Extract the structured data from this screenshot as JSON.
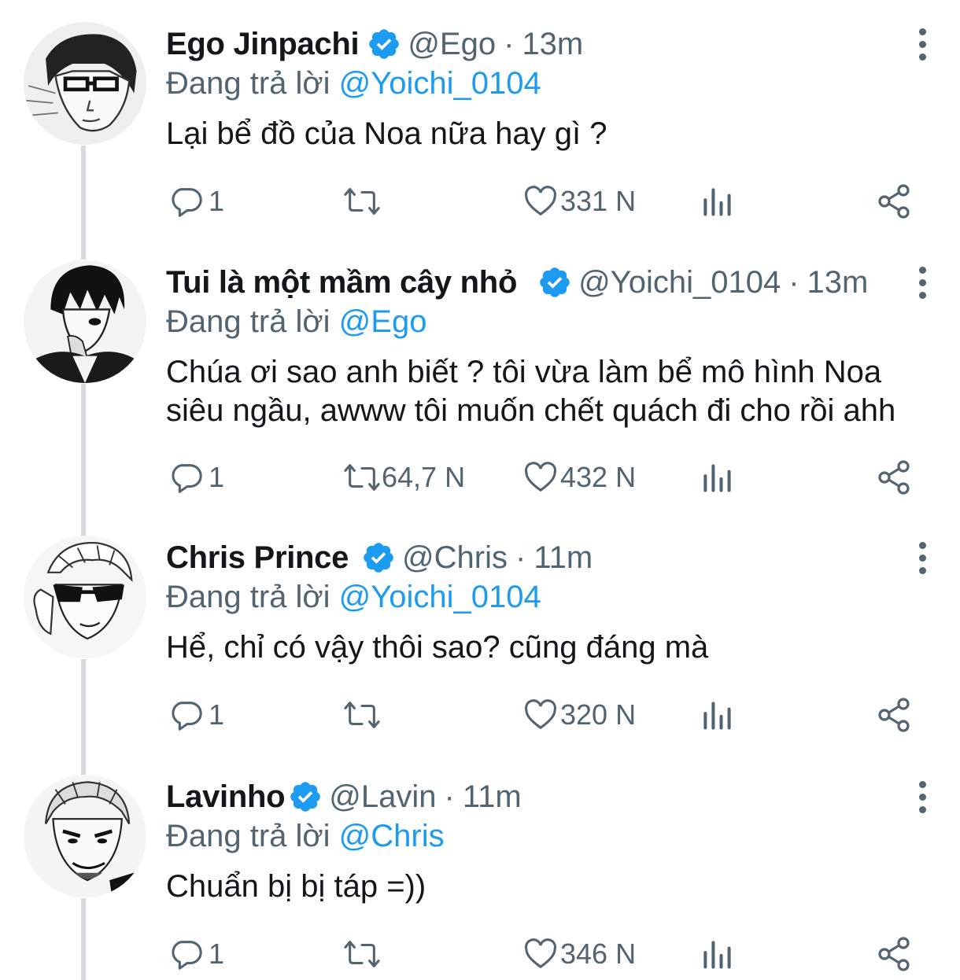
{
  "colors": {
    "accent": "#1d9bf0",
    "muted": "#536471",
    "text": "#14171a",
    "thread_line": "#d6dbe0"
  },
  "icons": {
    "reply": "comment-bubble-icon",
    "retweet": "retweet-arrows-icon",
    "like": "heart-icon",
    "stats": "bar-chart-icon",
    "share": "share-icon",
    "verified": "verified-badge-icon",
    "more": "vertical-dots-icon"
  },
  "tweets": [
    {
      "name": "Ego Jinpachi",
      "handle": "@Ego",
      "separator": "·",
      "time": "13m",
      "replying_prefix": "Đang trả lời",
      "replying_to": "@Yoichi_0104",
      "text": "Lại bể đồ của Noa nữa hay gì ?",
      "replies": "1",
      "retweets": "",
      "likes": "331 N"
    },
    {
      "name": "Tui là một mầm cây nhỏ",
      "handle": "@Yoichi_0104",
      "separator": "·",
      "time": "13m",
      "replying_prefix": "Đang trả lời",
      "replying_to": "@Ego",
      "text": "Chúa ơi sao anh biết ? tôi vừa làm bể mô hình Noa siêu ngầu, awww tôi muốn chết quách đi cho rồi ahh",
      "replies": "1",
      "retweets": "64,7 N",
      "likes": "432 N"
    },
    {
      "name": "Chris Prince",
      "handle": "@Chris",
      "separator": "·",
      "time": "11m",
      "replying_prefix": "Đang trả lời",
      "replying_to": "@Yoichi_0104",
      "text": "Hể, chỉ có vậy thôi sao? cũng đáng mà",
      "replies": "1",
      "retweets": "",
      "likes": "320 N"
    },
    {
      "name": "Lavinho",
      "handle": "@Lavin",
      "separator": "·",
      "time": "11m",
      "replying_prefix": "Đang trả lời",
      "replying_to": "@Chris",
      "text": "Chuẩn bị bị táp =))",
      "replies": "1",
      "retweets": "",
      "likes": "346 N"
    }
  ]
}
